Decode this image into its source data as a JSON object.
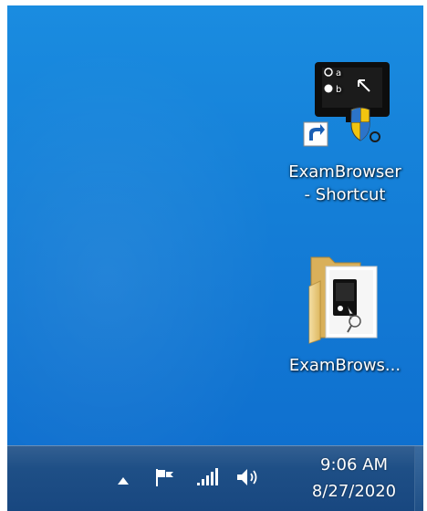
{
  "desktop": {
    "icons": [
      {
        "label_line1": "ExamBrowser",
        "label_line2": "- Shortcut",
        "icon": "exam-browser-shortcut-icon"
      },
      {
        "label": "ExamBrows...",
        "icon": "folder-icon"
      }
    ]
  },
  "taskbar": {
    "tray": {
      "show_hidden_icon": "up-arrow-icon",
      "action_center_icon": "flag-icon",
      "network_icon": "network-signal-icon",
      "volume_icon": "speaker-icon"
    },
    "clock": {
      "time": "9:06 AM",
      "date": "8/27/2020"
    }
  },
  "colors": {
    "desktop_background": "#1580d8",
    "taskbar_background": "#1e4f86",
    "label_text": "#ffffff"
  }
}
